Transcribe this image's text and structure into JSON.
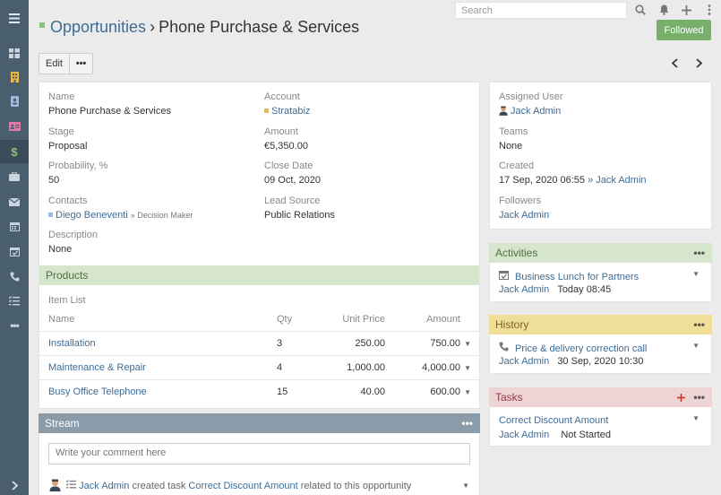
{
  "sidebar": {
    "items": [
      {
        "icon": "menu-icon"
      },
      {
        "icon": "dashboard-icon"
      },
      {
        "icon": "building-icon",
        "color": "#e8b94a"
      },
      {
        "icon": "contact-book-icon",
        "color": "#9fb8dd"
      },
      {
        "icon": "id-card-icon",
        "color": "#e07aa8"
      },
      {
        "icon": "dollar-icon",
        "color": "#8cc07e"
      },
      {
        "icon": "briefcase-icon"
      },
      {
        "icon": "envelope-icon"
      },
      {
        "icon": "calendar-icon"
      },
      {
        "icon": "calendar-check-icon"
      },
      {
        "icon": "phone-icon"
      },
      {
        "icon": "task-list-icon"
      },
      {
        "icon": "more-icon"
      },
      {
        "icon": "chevron-right-icon"
      }
    ]
  },
  "topbar": {
    "search_placeholder": "Search"
  },
  "header": {
    "breadcrumb": "Opportunities",
    "separator": "›",
    "title": "Phone Purchase & Services",
    "followed_label": "Followed"
  },
  "actions": {
    "edit_label": "Edit",
    "more_label": "•••"
  },
  "details": {
    "name_label": "Name",
    "name_value": "Phone Purchase & Services",
    "account_label": "Account",
    "account_value": "Stratabiz",
    "stage_label": "Stage",
    "stage_value": "Proposal",
    "amount_label": "Amount",
    "amount_value": "€5,350.00",
    "probability_label": "Probability, %",
    "probability_value": "50",
    "close_date_label": "Close Date",
    "close_date_value": "09 Oct, 2020",
    "contacts_label": "Contacts",
    "contact_name": "Diego Beneventi",
    "contact_role": "» Decision Maker",
    "lead_source_label": "Lead Source",
    "lead_source_value": "Public Relations",
    "description_label": "Description",
    "description_value": "None"
  },
  "products": {
    "header": "Products",
    "item_list_label": "Item List",
    "columns": {
      "name": "Name",
      "qty": "Qty",
      "unit_price": "Unit Price",
      "amount": "Amount"
    },
    "rows": [
      {
        "name": "Installation",
        "qty": "3",
        "unit_price": "250.00",
        "amount": "750.00"
      },
      {
        "name": "Maintenance & Repair",
        "qty": "4",
        "unit_price": "1,000.00",
        "amount": "4,000.00"
      },
      {
        "name": "Busy Office Telephone",
        "qty": "15",
        "unit_price": "40.00",
        "amount": "600.00"
      }
    ]
  },
  "stream": {
    "header": "Stream",
    "comment_placeholder": "Write your comment here",
    "entry": {
      "user": "Jack Admin",
      "action": "created task",
      "target": "Correct Discount Amount",
      "suffix": "related to this opportunity"
    }
  },
  "side": {
    "assigned_user_label": "Assigned User",
    "assigned_user_value": "Jack Admin",
    "teams_label": "Teams",
    "teams_value": "None",
    "created_label": "Created",
    "created_date": "17 Sep, 2020 06:55",
    "created_sep": "»",
    "created_by": "Jack Admin",
    "followers_label": "Followers",
    "followers_value": "Jack Admin"
  },
  "activities": {
    "header": "Activities",
    "item_title": "Business Lunch for Partners",
    "item_user": "Jack Admin",
    "item_time": "Today 08:45"
  },
  "history": {
    "header": "History",
    "item_title": "Price & delivery correction call",
    "item_user": "Jack Admin",
    "item_time": "30 Sep, 2020 10:30"
  },
  "tasks": {
    "header": "Tasks",
    "item_title": "Correct Discount Amount",
    "item_user": "Jack Admin",
    "item_status": "Not Started"
  },
  "colors": {
    "sidebar_bg": "#4a5f6e",
    "link": "#3e6d96",
    "followed_bg": "#77b06b",
    "products_header": "#d6e6cc",
    "stream_header": "#8a9ca9",
    "activities_header": "#d6e6cc",
    "history_header": "#f0df98",
    "tasks_header": "#efd4d6",
    "tasks_plus": "#c0392b"
  }
}
